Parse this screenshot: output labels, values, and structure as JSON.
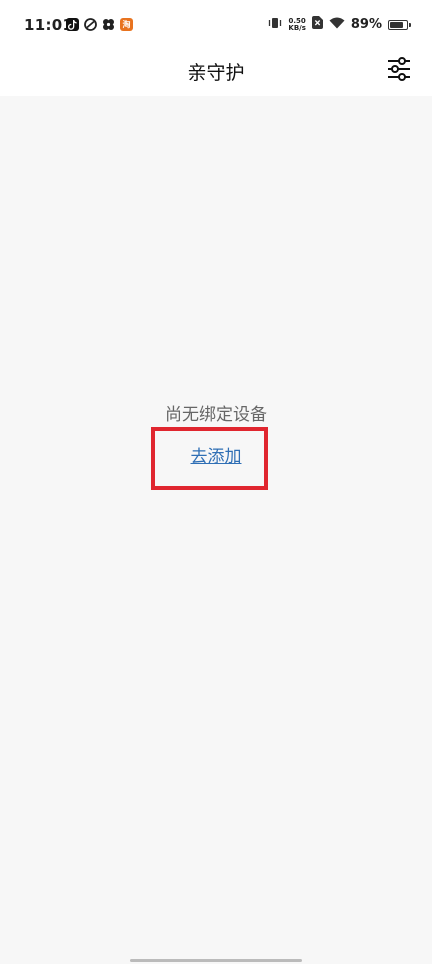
{
  "status_bar": {
    "time": "11:01",
    "notification_icons": [
      "tiktok-icon",
      "sync-app-icon",
      "pinwheel-app-icon",
      "taobao-icon"
    ],
    "taobao_glyph": "淘",
    "net_speed_value": "0.50",
    "net_speed_unit": "KB/s",
    "battery_percent": "89%",
    "battery_level": 0.89
  },
  "nav": {
    "title": "亲守护"
  },
  "empty_state": {
    "message": "尚无绑定设备",
    "add_link_label": "去添加"
  },
  "colors": {
    "link": "#2f6fb5",
    "highlight": "#e0262f",
    "background": "#f7f7f7",
    "taobao": "#e8731f"
  }
}
